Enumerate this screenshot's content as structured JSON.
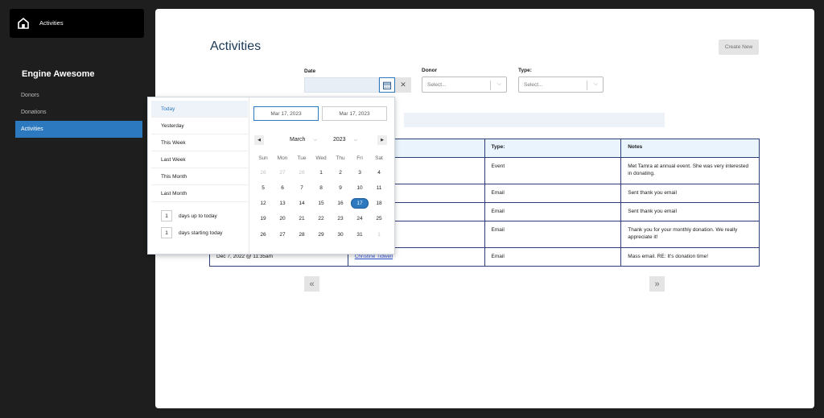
{
  "sidebar": {
    "home_label": "Activities",
    "brand": "Engine Awesome",
    "items": [
      {
        "label": "Donors",
        "active": false
      },
      {
        "label": "Donations",
        "active": false
      },
      {
        "label": "Activities",
        "active": true
      }
    ]
  },
  "page": {
    "title": "Activities",
    "create_label": "Create New"
  },
  "filters": {
    "date_label": "Date",
    "date_value": "",
    "donor_label": "Donor",
    "donor_placeholder": "Select...",
    "type_label": "Type:",
    "type_placeholder": "Select...",
    "clear_symbol": "✕"
  },
  "table": {
    "headers": [
      "",
      "",
      "Type:",
      "Notes"
    ],
    "rows": [
      {
        "date": "",
        "donor": "",
        "type": "Event",
        "notes": "Met Tamra at annual event. She was very interested in donating."
      },
      {
        "date": "",
        "donor": "",
        "type": "Email",
        "notes": "Sent thank you email"
      },
      {
        "date": "",
        "donor": "",
        "type": "Email",
        "notes": "Sent thank you email"
      },
      {
        "date": "",
        "donor": "]",
        "type": "Email",
        "notes": "Thank you for your monthly donation. We really appreciate it!"
      },
      {
        "date": "Dec 7, 2022 @ 11:35am",
        "donor": "Christine Tidwell",
        "type": "Email",
        "notes": "Mass email. RE: It's donation time!"
      }
    ]
  },
  "pager": {
    "prev": "«",
    "next": "»"
  },
  "datepicker": {
    "ranges": [
      "Today",
      "Yesterday",
      "This Week",
      "Last Week",
      "This Month",
      "Last Month"
    ],
    "active_range": "Today",
    "days_up": {
      "value": "1",
      "label": "days up to today"
    },
    "days_starting": {
      "value": "1",
      "label": "days starting today"
    },
    "start_date": "Mar 17, 2023",
    "end_date": "Mar 17, 2023",
    "month": "March",
    "year": "2023",
    "prev_arrow": "◀",
    "next_arrow": "▶",
    "weekdays": [
      "Sun",
      "Mon",
      "Tue",
      "Wed",
      "Thu",
      "Fri",
      "Sat"
    ],
    "weeks": [
      [
        "26",
        "27",
        "28",
        "1",
        "2",
        "3",
        "4"
      ],
      [
        "5",
        "6",
        "7",
        "8",
        "9",
        "10",
        "11"
      ],
      [
        "12",
        "13",
        "14",
        "15",
        "16",
        "17",
        "18"
      ],
      [
        "19",
        "20",
        "21",
        "22",
        "23",
        "24",
        "25"
      ],
      [
        "26",
        "27",
        "28",
        "29",
        "30",
        "31",
        "1"
      ]
    ],
    "muted": [
      [
        0,
        0
      ],
      [
        0,
        1
      ],
      [
        0,
        2
      ],
      [
        4,
        6
      ]
    ],
    "selected": [
      2,
      5
    ]
  },
  "colors": {
    "accent": "#2d79c0",
    "table_border": "#2c3e75",
    "header_bg": "#eaf4fd"
  }
}
